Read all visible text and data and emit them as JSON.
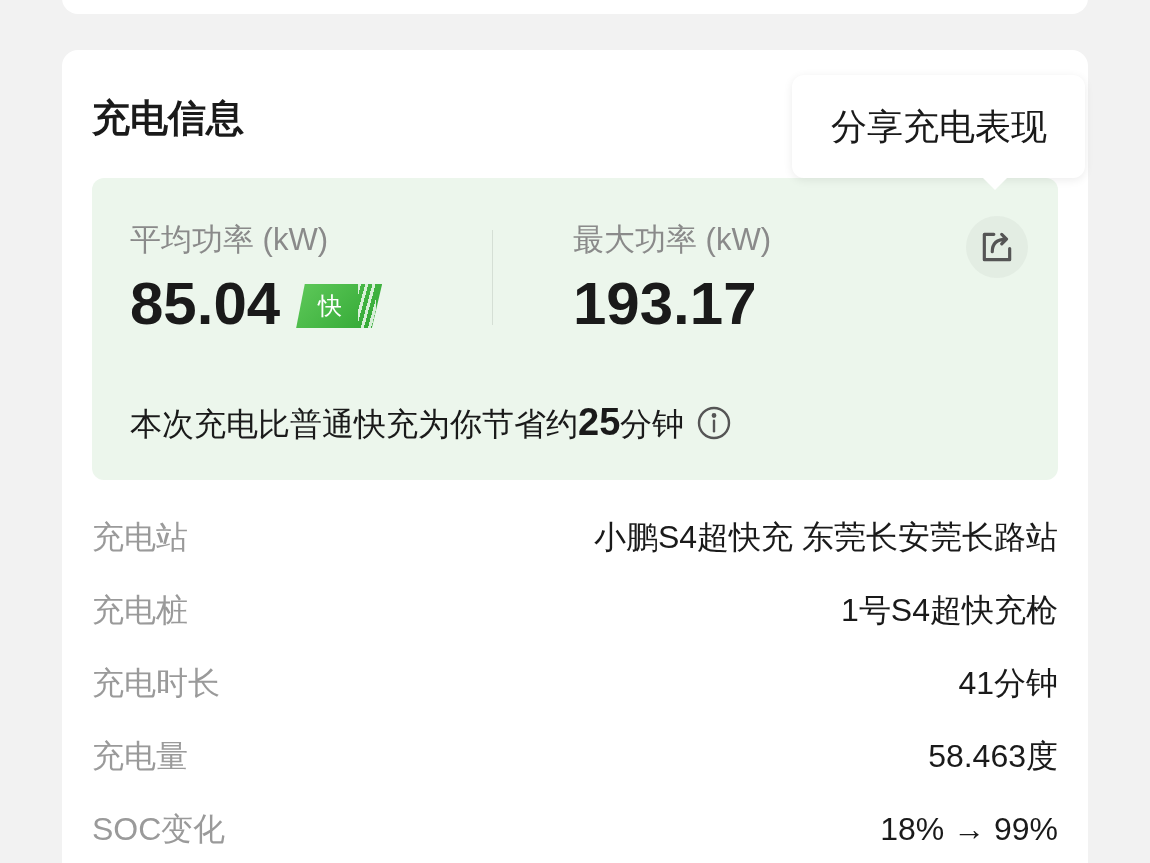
{
  "title": "充电信息",
  "tooltip": {
    "text": "分享充电表现"
  },
  "power": [
    {
      "label": "平均功率 (kW)",
      "value": "85.04",
      "badge": "快"
    },
    {
      "label": "最大功率 (kW)",
      "value": "193.17"
    }
  ],
  "savings": "本次充电比普通快充为你节省约**25**分钟",
  "details": [
    {
      "label": "充电站",
      "value": "小鹏S4超快充 东莞长安莞长路站"
    },
    {
      "label": "充电桩",
      "value": "1号S4超快充枪"
    },
    {
      "label": "充电时长",
      "value": "41分钟"
    },
    {
      "label": "充电量",
      "value": "58.463度"
    },
    {
      "label": "SOC变化",
      "value": "18% → 99%"
    }
  ]
}
